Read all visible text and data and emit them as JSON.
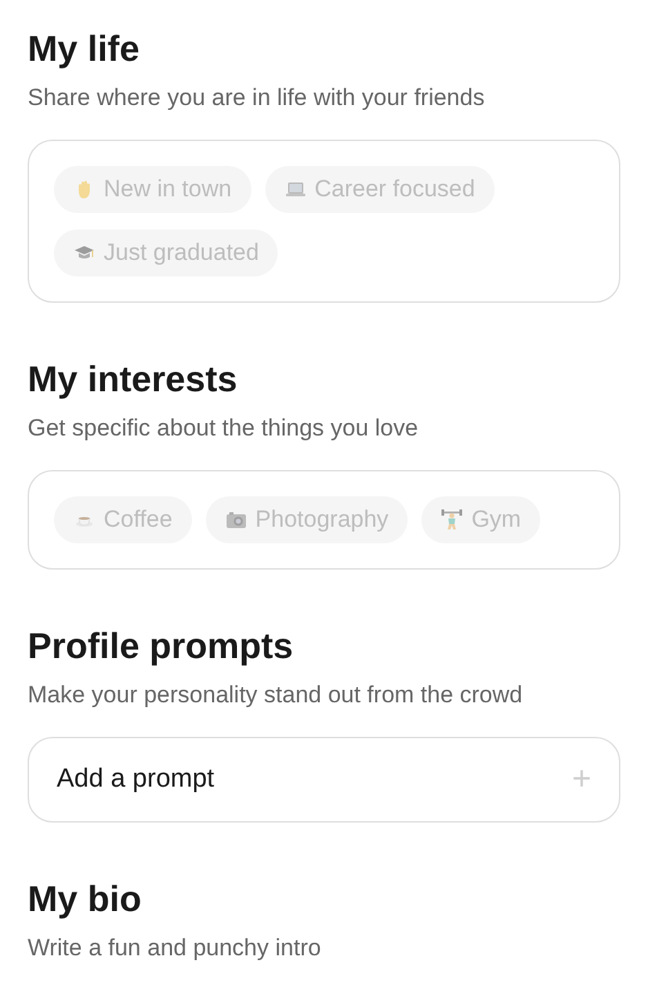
{
  "sections": [
    {
      "title": "My life",
      "subtitle": "Share where you are in life with your friends",
      "kind": "chips",
      "chips": [
        {
          "label": "New in town",
          "kind": "hand"
        },
        {
          "label": "Career focused",
          "kind": "laptop"
        },
        {
          "label": "Just graduated",
          "kind": "cap"
        }
      ]
    },
    {
      "title": "My interests",
      "subtitle": "Get specific about the things you love",
      "kind": "chips",
      "chips": [
        {
          "label": "Coffee",
          "kind": "cup"
        },
        {
          "label": "Photography",
          "kind": "camera"
        },
        {
          "label": "Gym",
          "kind": "lifter"
        }
      ]
    },
    {
      "title": "Profile prompts",
      "subtitle": "Make your personality stand out from the crowd",
      "kind": "prompt",
      "prompt": {
        "label": "Add a prompt",
        "icon": "+"
      }
    },
    {
      "title": "My bio",
      "subtitle": "Write a fun and punchy intro",
      "kind": "none"
    }
  ]
}
